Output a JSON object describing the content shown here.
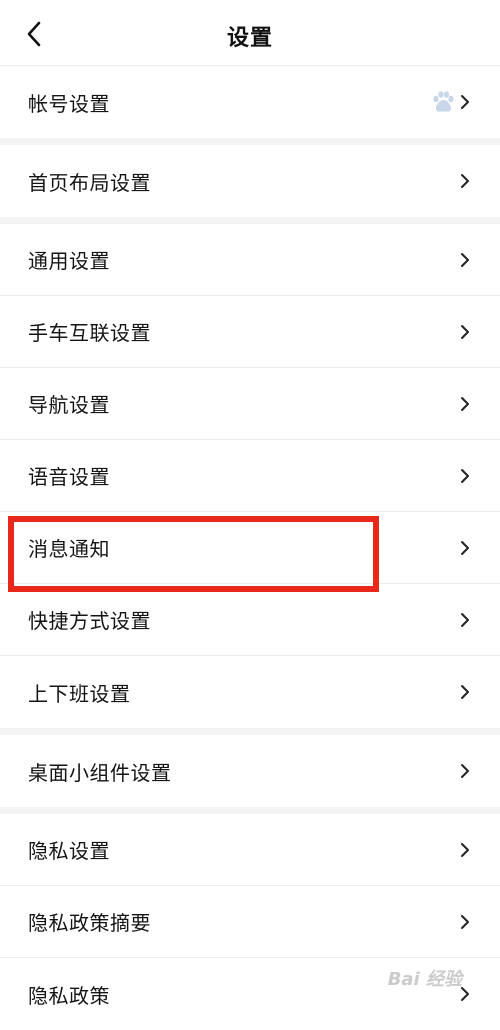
{
  "header": {
    "title": "设置",
    "back_icon": "back-chevron-icon"
  },
  "groups": [
    {
      "items": [
        {
          "label": "帐号设置",
          "extra_icon": "baidu-paw-icon"
        }
      ]
    },
    {
      "items": [
        {
          "label": "首页布局设置"
        }
      ]
    },
    {
      "items": [
        {
          "label": "通用设置"
        },
        {
          "label": "手车互联设置"
        },
        {
          "label": "导航设置"
        },
        {
          "label": "语音设置"
        },
        {
          "label": "消息通知",
          "highlighted": true
        },
        {
          "label": "快捷方式设置"
        },
        {
          "label": "上下班设置"
        }
      ]
    },
    {
      "items": [
        {
          "label": "桌面小组件设置"
        }
      ]
    },
    {
      "items": [
        {
          "label": "隐私设置"
        },
        {
          "label": "隐私政策摘要"
        },
        {
          "label": "隐私政策"
        }
      ]
    }
  ],
  "highlight_color": "#e8281b",
  "watermark": {
    "text": "Bai 经验"
  }
}
